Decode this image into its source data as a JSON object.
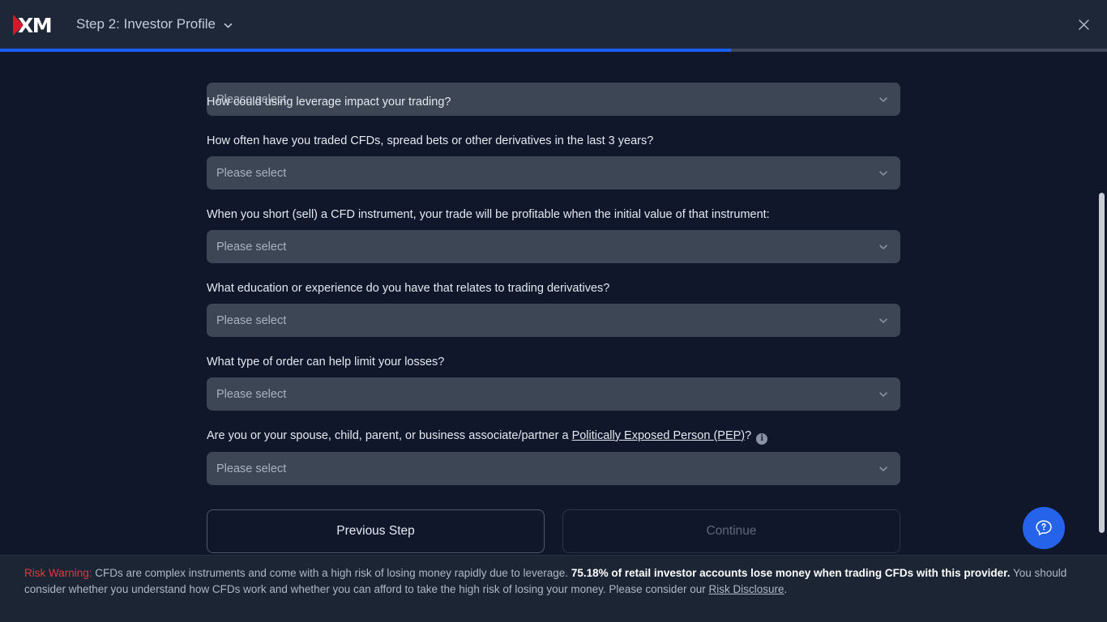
{
  "header": {
    "logo_alt": "XM",
    "logo_text": "XM",
    "title": "Step 2: Investor Profile",
    "chevron_icon": "chevron-down-icon",
    "close_icon": "close-icon"
  },
  "progress": {
    "percent": 66,
    "fill_color": "#1b5cf2",
    "track_color": "#3c4656"
  },
  "clipped_question": "How could using leverage impact your trading?",
  "form": {
    "placeholder": "Please select",
    "chevron_icon": "chevron-down-icon",
    "fields": [
      {
        "id": "leverage-impact",
        "label": "How could using leverage impact your trading?",
        "value": "",
        "placeholder": "Please select",
        "clipped": true
      },
      {
        "id": "trading-frequency",
        "label": "How often have you traded CFDs, spread bets or other derivatives in the last 3 years?",
        "value": "",
        "placeholder": "Please select"
      },
      {
        "id": "short-sell-knowledge",
        "label": "When you short (sell) a CFD instrument, your trade will be profitable when the initial value of that instrument:",
        "value": "",
        "placeholder": "Please select"
      },
      {
        "id": "education-experience",
        "label": "What education or experience do you have that relates to trading derivatives?",
        "value": "",
        "placeholder": "Please select"
      },
      {
        "id": "order-type",
        "label": "What type of order can help limit your losses?",
        "value": "",
        "placeholder": "Please select"
      }
    ],
    "pep_field": {
      "id": "politically-exposed-person",
      "label_before": "Are you or your spouse, child, parent, or business associate/partner a ",
      "label_link": "Politically Exposed Person (PEP)",
      "label_after": "?",
      "info_icon": "info-icon",
      "info_glyph": "i",
      "value": "",
      "placeholder": "Please select"
    }
  },
  "buttons": {
    "previous": "Previous Step",
    "continue": "Continue",
    "continue_disabled": true
  },
  "chat": {
    "icon": "chat-question-icon",
    "color": "#2563eb"
  },
  "risk_warning": {
    "label": "Risk Warning:",
    "text_1": " CFDs are complex instruments and come with a high risk of losing money rapidly due to leverage. ",
    "bold_1": "75.18% of retail investor accounts lose money when trading CFDs with this provider.",
    "text_2": " You should consider whether you understand how CFDs work and whether you can afford to take the high risk of losing your money. Please consider our ",
    "link": "Risk Disclosure",
    "text_3": "."
  },
  "colors": {
    "page_bg": "#11172a",
    "header_bg": "#1e2738",
    "field_bg": "#3d4654",
    "accent_blue": "#1b5cf2",
    "risk_red": "#e0383f",
    "logo_red": "#d7182a"
  }
}
